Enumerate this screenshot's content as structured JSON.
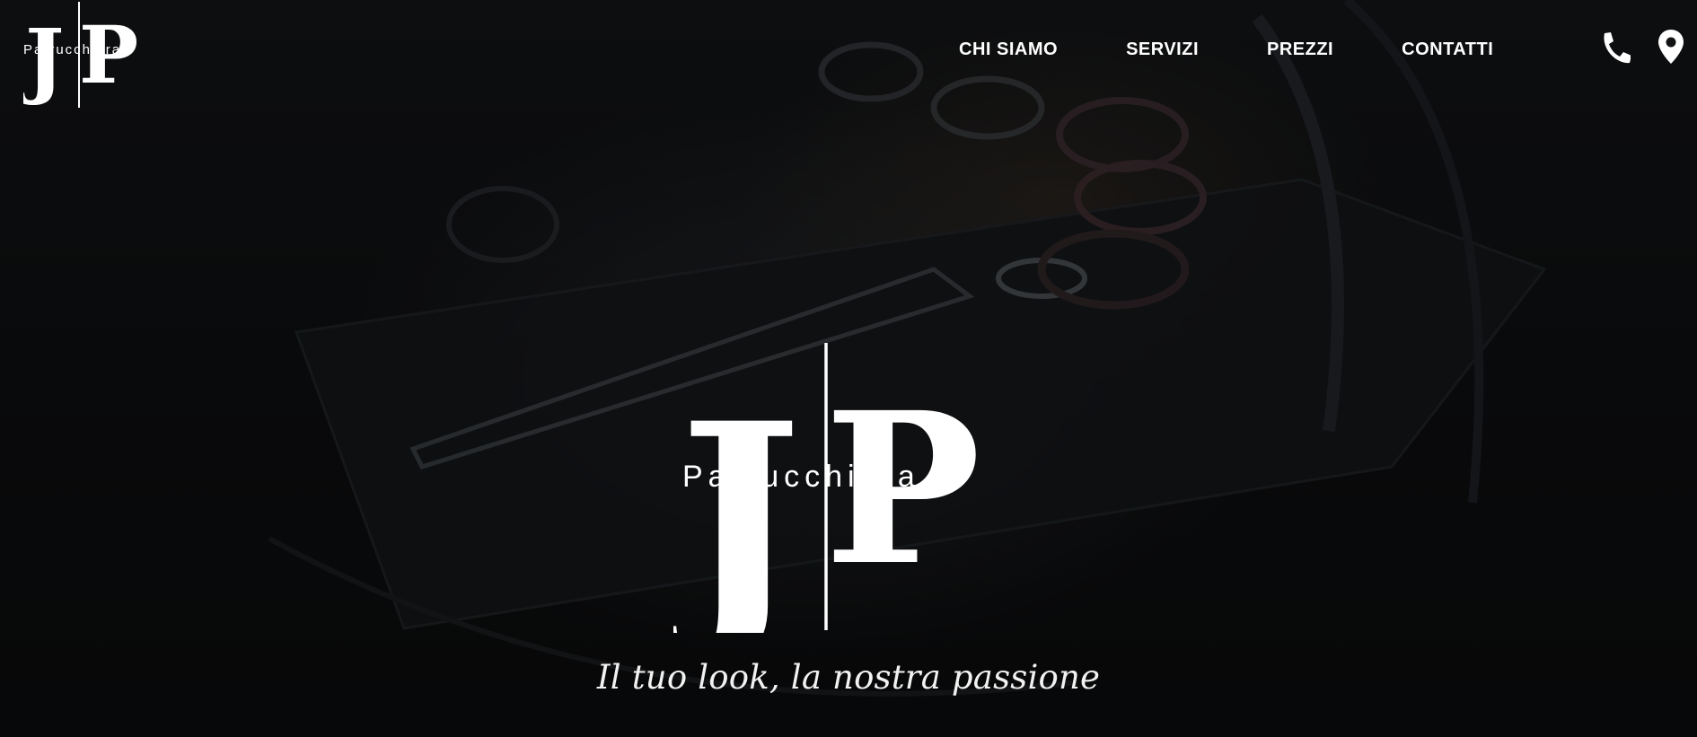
{
  "brand": {
    "monogram_left": "J",
    "monogram_right": "P",
    "name": "Parrucchiera"
  },
  "nav": {
    "items": [
      {
        "label": "CHI SIAMO"
      },
      {
        "label": "SERVIZI"
      },
      {
        "label": "PREZZI"
      },
      {
        "label": "CONTATTI"
      }
    ]
  },
  "icons": {
    "phone": "phone-icon",
    "location": "location-pin-icon"
  },
  "hero": {
    "tagline": "Il tuo look, la nostra passione"
  },
  "colors": {
    "text": "#ffffff",
    "background": "#0c0d0f"
  }
}
